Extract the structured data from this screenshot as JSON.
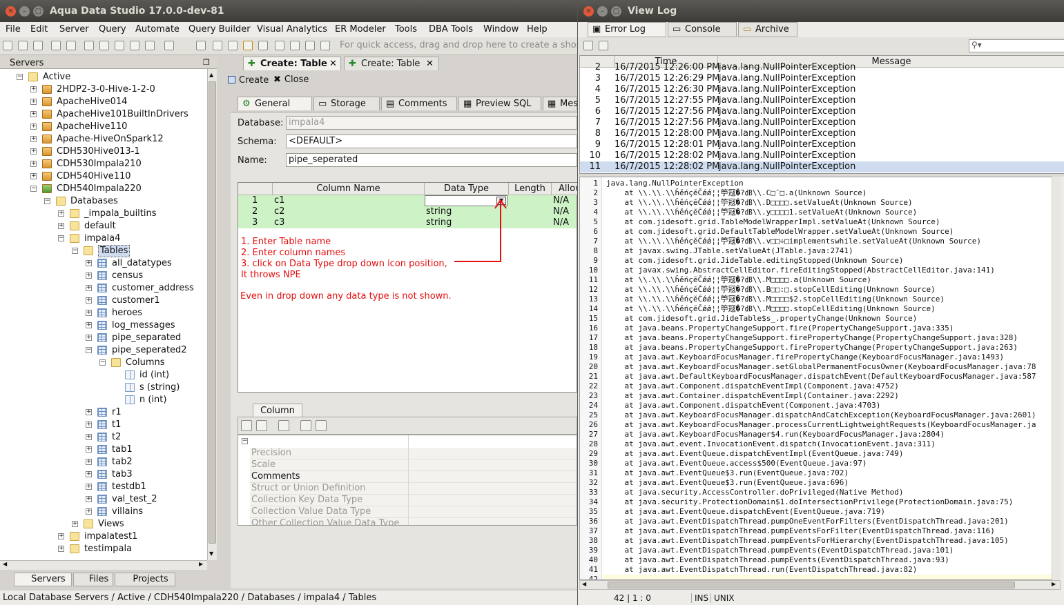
{
  "app": {
    "title": "Aqua Data Studio 17.0.0-dev-81"
  },
  "menu": [
    "File",
    "Edit",
    "Server",
    "Query",
    "Automate",
    "Query Builder",
    "Visual Analytics",
    "ER Modeler",
    "Tools",
    "DBA Tools",
    "Window",
    "Help"
  ],
  "toolbar": {
    "hint": "For quick access, drag and drop here to create a shor"
  },
  "servers": {
    "title": "Servers",
    "tree": [
      {
        "label": "Active",
        "icon": "folder-icon"
      },
      {
        "label": "2HDP2-3-0-Hive-1-2-0",
        "icon": "server-icon"
      },
      {
        "label": "ApacheHive014",
        "icon": "server-icon"
      },
      {
        "label": "ApacheHive101BuiltInDrivers",
        "icon": "server-icon"
      },
      {
        "label": "ApacheHive110",
        "icon": "server-icon"
      },
      {
        "label": "Apache-HiveOnSpark12",
        "icon": "server-icon"
      },
      {
        "label": "CDH530Hive013-1",
        "icon": "server-icon"
      },
      {
        "label": "CDH530Impala210",
        "icon": "server-icon"
      },
      {
        "label": "CDH540Hive110",
        "icon": "server-icon"
      },
      {
        "label": "CDH540Impala220",
        "icon": "server-connected-icon"
      },
      {
        "label": "Databases",
        "icon": "folder-icon"
      },
      {
        "label": "_impala_builtins",
        "icon": "folder-icon"
      },
      {
        "label": "default",
        "icon": "folder-icon"
      },
      {
        "label": "impala4",
        "icon": "folder-icon"
      },
      {
        "label": "Tables",
        "icon": "folder-icon"
      },
      {
        "label": "all_datatypes",
        "icon": "table-icon"
      },
      {
        "label": "census",
        "icon": "table-icon"
      },
      {
        "label": "customer_address",
        "icon": "table-icon"
      },
      {
        "label": "customer1",
        "icon": "table-icon"
      },
      {
        "label": "heroes",
        "icon": "table-icon"
      },
      {
        "label": "log_messages",
        "icon": "table-icon"
      },
      {
        "label": "pipe_separated",
        "icon": "table-icon"
      },
      {
        "label": "pipe_seperated2",
        "icon": "table-icon"
      },
      {
        "label": "Columns",
        "icon": "folder-icon"
      },
      {
        "label": "id (int)",
        "icon": "column-icon"
      },
      {
        "label": "s (string)",
        "icon": "column-icon"
      },
      {
        "label": "n (int)",
        "icon": "column-icon"
      },
      {
        "label": "r1",
        "icon": "table-icon"
      },
      {
        "label": "t1",
        "icon": "table-icon"
      },
      {
        "label": "t2",
        "icon": "table-icon"
      },
      {
        "label": "tab1",
        "icon": "table-icon"
      },
      {
        "label": "tab2",
        "icon": "table-icon"
      },
      {
        "label": "tab3",
        "icon": "table-icon"
      },
      {
        "label": "testdb1",
        "icon": "table-icon"
      },
      {
        "label": "val_test_2",
        "icon": "table-icon"
      },
      {
        "label": "villains",
        "icon": "table-icon"
      },
      {
        "label": "Views",
        "icon": "folder-icon"
      },
      {
        "label": "impalatest1",
        "icon": "folder-icon"
      },
      {
        "label": "testimpala",
        "icon": "folder-icon"
      }
    ]
  },
  "bottom_tabs": [
    "Servers",
    "Files",
    "Projects"
  ],
  "statusbar": {
    "path": "Local Database Servers / Active / CDH540Impala220 / Databases / impala4 / Tables"
  },
  "editor": {
    "doc_tabs": [
      "Create: Table",
      "Create: Table"
    ],
    "actions": [
      "Create",
      "Close"
    ],
    "subtabs": [
      "General",
      "Storage",
      "Comments",
      "Preview SQL",
      "Mes"
    ],
    "database_label": "Database:",
    "database_value": "impala4",
    "schema_label": "Schema:",
    "schema_value": "<DEFAULT>",
    "name_label": "Name:",
    "name_value": "pipe_seperated",
    "grid": {
      "headers": [
        "Column Name",
        "Data Type",
        "Length",
        "Allow"
      ],
      "rows": [
        {
          "num": "1",
          "name": "c1",
          "type": "",
          "allow": "N/A"
        },
        {
          "num": "2",
          "name": "c2",
          "type": "string",
          "allow": "N/A"
        },
        {
          "num": "3",
          "name": "c3",
          "type": "string",
          "allow": "N/A"
        }
      ]
    },
    "annotation": {
      "lines": [
        "1. Enter Table name",
        "2. Enter column names",
        "3. click on Data Type drop down icon position,",
        "It throws NPE"
      ],
      "footer": "Even in drop down any data type is not shown."
    },
    "column_tab": "Column",
    "properties": [
      "Precision",
      "Scale",
      "Comments",
      "Struct or Union Definition",
      "Collection Key Data Type",
      "Collection Value Data Type",
      "Other Collection Value Data Type"
    ]
  },
  "viewlog": {
    "title": "View Log",
    "tabs": [
      "Error Log",
      "Console",
      "Archive"
    ],
    "headers": [
      "Time",
      "Message"
    ],
    "rows": [
      {
        "n": "2",
        "time": "16/7/2015 12:26:00 PM",
        "msg": "java.lang.NullPointerException"
      },
      {
        "n": "3",
        "time": "16/7/2015 12:26:29 PM",
        "msg": "java.lang.NullPointerException"
      },
      {
        "n": "4",
        "time": "16/7/2015 12:26:30 PM",
        "msg": "java.lang.NullPointerException"
      },
      {
        "n": "5",
        "time": "16/7/2015 12:27:55 PM",
        "msg": "java.lang.NullPointerException"
      },
      {
        "n": "6",
        "time": "16/7/2015 12:27:56 PM",
        "msg": "java.lang.NullPointerException"
      },
      {
        "n": "7",
        "time": "16/7/2015 12:27:56 PM",
        "msg": "java.lang.NullPointerException"
      },
      {
        "n": "8",
        "time": "16/7/2015 12:28:00 PM",
        "msg": "java.lang.NullPointerException"
      },
      {
        "n": "9",
        "time": "16/7/2015 12:28:01 PM",
        "msg": "java.lang.NullPointerException"
      },
      {
        "n": "10",
        "time": "16/7/2015 12:28:02 PM",
        "msg": "java.lang.NullPointerException"
      },
      {
        "n": "11",
        "time": "16/7/2015 12:28:02 PM",
        "msg": "java.lang.NullPointerException"
      }
    ],
    "trace": [
      "java.lang.NullPointerException",
      "    at \\\\.\\\\.\\\\ĥěńçĕČǿǿ¦¦䇡冦�?㏈\\\\.C□¯□.a(Unknown Source)",
      "    at \\\\.\\\\.\\\\ĥěńçĕČǿǿ¦¦䇡冦�?㏈\\\\.D□□□□.setValueAt(Unknown Source)",
      "    at \\\\.\\\\.\\\\ĥěńçĕČǿǿ¦¦䇡冦�?㏈\\\\.y□□□□1.setValueAt(Unknown Source)",
      "    at com.jidesoft.grid.TableModelWrapperImpl.setValueAt(Unknown Source)",
      "    at com.jidesoft.grid.DefaultTableModelWrapper.setValueAt(Unknown Source)",
      "    at \\\\.\\\\.\\\\ĥěńçĕČǿǿ¦¦䇡冦�?㏈\\\\.v□□÷□implementswhile.setValueAt(Unknown Source)",
      "    at javax.swing.JTable.setValueAt(JTable.java:2741)",
      "    at com.jidesoft.grid.JideTable.editingStopped(Unknown Source)",
      "    at javax.swing.AbstractCellEditor.fireEditingStopped(AbstractCellEditor.java:141)",
      "    at \\\\.\\\\.\\\\ĥěńçĕČǿǿ¦¦䇡冦�?㏈\\\\.M□□□□.a(Unknown Source)",
      "    at \\\\.\\\\.\\\\ĥěńçĕČǿǿ¦¦䇡冦�?㏈\\\\.B□□:□.stopCellEditing(Unknown Source)",
      "    at \\\\.\\\\.\\\\ĥěńçĕČǿǿ¦¦䇡冦�?㏈\\\\.M□□□□$2.stopCellEditing(Unknown Source)",
      "    at \\\\.\\\\.\\\\ĥěńçĕČǿǿ¦¦䇡冦�?㏈\\\\.M□□□□.stopCellEditing(Unknown Source)",
      "    at com.jidesoft.grid.JideTable$s_.propertyChange(Unknown Source)",
      "    at java.beans.PropertyChangeSupport.fire(PropertyChangeSupport.java:335)",
      "    at java.beans.PropertyChangeSupport.firePropertyChange(PropertyChangeSupport.java:328)",
      "    at java.beans.PropertyChangeSupport.firePropertyChange(PropertyChangeSupport.java:263)",
      "    at java.awt.KeyboardFocusManager.firePropertyChange(KeyboardFocusManager.java:1493)",
      "    at java.awt.KeyboardFocusManager.setGlobalPermanentFocusOwner(KeyboardFocusManager.java:78",
      "    at java.awt.DefaultKeyboardFocusManager.dispatchEvent(DefaultKeyboardFocusManager.java:587",
      "    at java.awt.Component.dispatchEventImpl(Component.java:4752)",
      "    at java.awt.Container.dispatchEventImpl(Container.java:2292)",
      "    at java.awt.Component.dispatchEvent(Component.java:4703)",
      "    at java.awt.KeyboardFocusManager.dispatchAndCatchException(KeyboardFocusManager.java:2601)",
      "    at java.awt.KeyboardFocusManager.processCurrentLightweightRequests(KeyboardFocusManager.ja",
      "    at java.awt.KeyboardFocusManager$4.run(KeyboardFocusManager.java:2804)",
      "    at java.awt.event.InvocationEvent.dispatch(InvocationEvent.java:311)",
      "    at java.awt.EventQueue.dispatchEventImpl(EventQueue.java:749)",
      "    at java.awt.EventQueue.access$500(EventQueue.java:97)",
      "    at java.awt.EventQueue$3.run(EventQueue.java:702)",
      "    at java.awt.EventQueue$3.run(EventQueue.java:696)",
      "    at java.security.AccessController.doPrivileged(Native Method)",
      "    at java.security.ProtectionDomain$1.doIntersectionPrivilege(ProtectionDomain.java:75)",
      "    at java.awt.EventQueue.dispatchEvent(EventQueue.java:719)",
      "    at java.awt.EventDispatchThread.pumpOneEventForFilters(EventDispatchThread.java:201)",
      "    at java.awt.EventDispatchThread.pumpEventsForFilter(EventDispatchThread.java:116)",
      "    at java.awt.EventDispatchThread.pumpEventsForHierarchy(EventDispatchThread.java:105)",
      "    at java.awt.EventDispatchThread.pumpEvents(EventDispatchThread.java:101)",
      "    at java.awt.EventDispatchThread.pumpEvents(EventDispatchThread.java:93)",
      "    at java.awt.EventDispatchThread.run(EventDispatchThread.java:82)"
    ],
    "status": {
      "pos": "42 | 1 : 0",
      "ins": "INS",
      "eol": "UNIX"
    }
  },
  "colors": {
    "grid_row": "#ccf2c6",
    "annotation": "#e40e0e",
    "selected_row": "#cfdcf0"
  }
}
